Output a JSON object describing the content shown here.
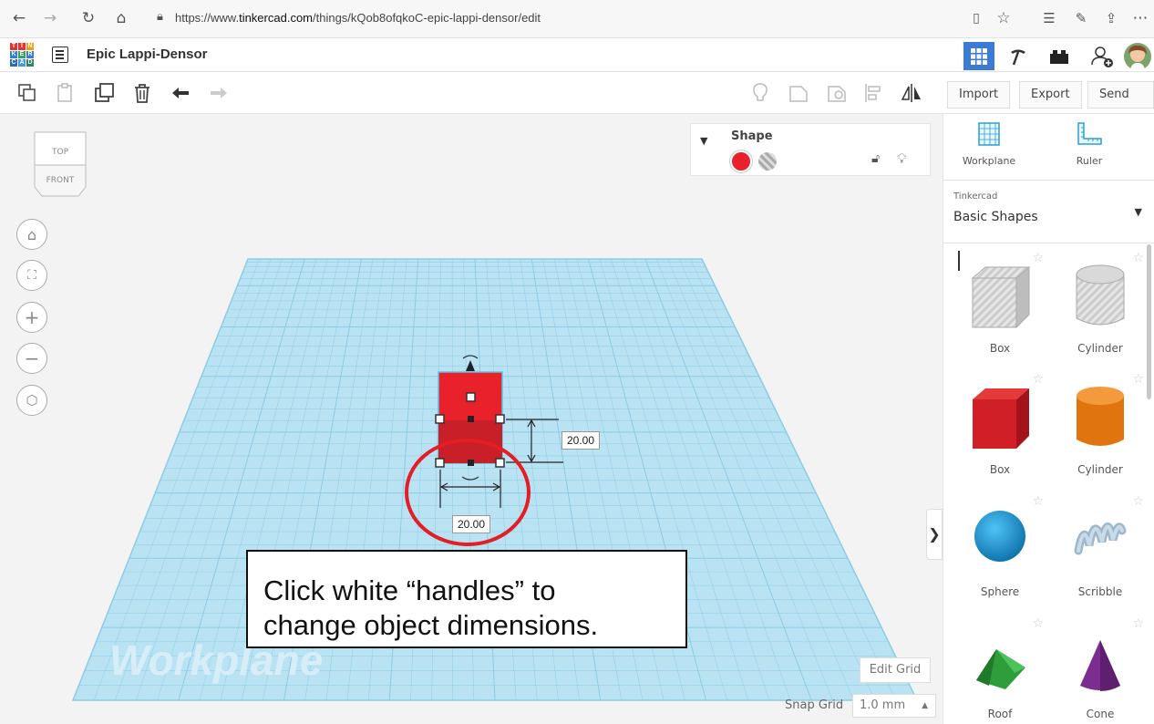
{
  "browser": {
    "url_prefix": "https://www.",
    "url_host": "tinkercad.com",
    "url_path": "/things/kQob8ofqkoC-epic-lappi-densor/edit"
  },
  "app": {
    "logo_letters": [
      "T",
      "I",
      "N",
      "K",
      "E",
      "R",
      "C",
      "A",
      "D"
    ],
    "project_title": "Epic Lappi-Densor"
  },
  "toolbar": {
    "import_label": "Import",
    "export_label": "Export",
    "sendto_label": "Send To"
  },
  "viewcube": {
    "top_label": "TOP",
    "front_label": "FRONT"
  },
  "shape_panel": {
    "title": "Shape",
    "color": "#e8212b"
  },
  "dimensions": {
    "height": "20.00",
    "width": "20.00"
  },
  "callout": {
    "line1": "Click white “handles” to",
    "line2": "change object dimensions."
  },
  "workplane_watermark": "Workplane",
  "grid": {
    "edit_label": "Edit Grid",
    "snap_label": "Snap Grid",
    "snap_value": "1.0 mm"
  },
  "right_panel": {
    "workplane_label": "Workplane",
    "ruler_label": "Ruler",
    "library_source": "Tinkercad",
    "library_name": "Basic Shapes",
    "shapes": [
      {
        "label": "Box"
      },
      {
        "label": "Cylinder"
      },
      {
        "label": "Box"
      },
      {
        "label": "Cylinder"
      },
      {
        "label": "Sphere"
      },
      {
        "label": "Scribble"
      },
      {
        "label": "Roof"
      },
      {
        "label": "Cone"
      }
    ]
  },
  "colors": {
    "accent": "#3a7bd5",
    "shape_red": "#e8212b",
    "grid_blue": "#9fd8ee",
    "annotation_red": "#e31e24"
  }
}
